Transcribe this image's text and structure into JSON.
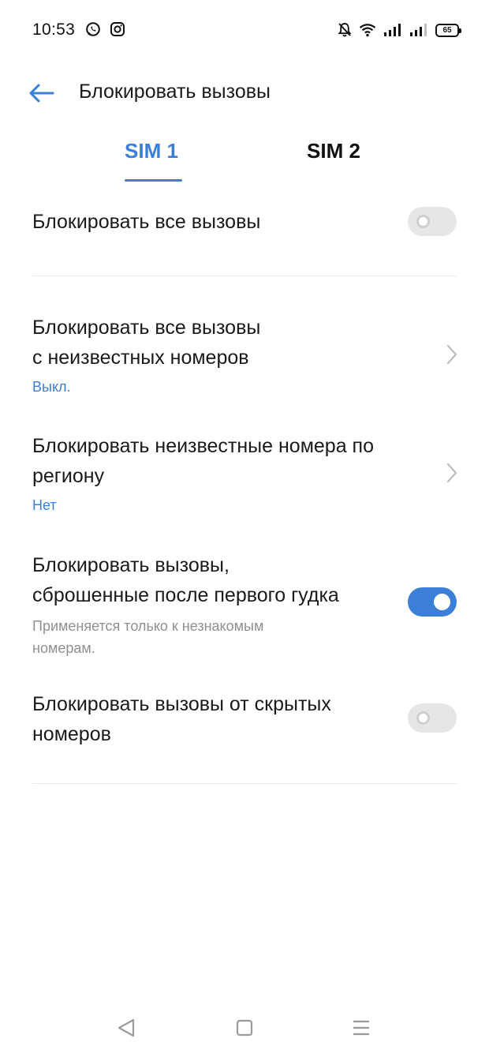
{
  "status_bar": {
    "time": "10:53",
    "app_icons": [
      "whatsapp-icon",
      "instagram-icon"
    ],
    "system_icons": [
      "bell-off-icon",
      "wifi-icon",
      "signal-icon",
      "signal-icon"
    ],
    "battery_level": "65"
  },
  "header": {
    "title": "Блокировать вызовы",
    "back_icon": "arrow-left-icon"
  },
  "tabs": [
    {
      "label": "SIM 1",
      "selected": true
    },
    {
      "label": "SIM 2",
      "selected": false
    }
  ],
  "settings": {
    "block_all": {
      "title": "Блокировать все вызовы",
      "enabled": false
    },
    "block_unknown": {
      "title_line1": "Блокировать все вызовы",
      "title_line2": "с неизвестных номеров",
      "value": "Выкл."
    },
    "block_region": {
      "title_line1": "Блокировать неизвестные номера по",
      "title_line2": "регион​у",
      "value": "Нет"
    },
    "block_one_ring": {
      "title_line1": "Блокировать вызовы,",
      "title_line2": "сброшенные после первого гудка",
      "desc_line1": "Применяется только к незнакомым",
      "desc_line2": "номерам.",
      "enabled": true
    },
    "block_hidden": {
      "title_line1": "Блокировать вызовы от скрытых",
      "title_line2": "номеров",
      "enabled": false
    }
  },
  "colors": {
    "accent": "#3a7fd8",
    "toggle_off": "#e6e6e6",
    "divider": "#e9e9e9",
    "secondary_text": "#8f8f8f"
  },
  "nav_bar": [
    "back-triangle-icon",
    "home-square-icon",
    "menu-lines-icon"
  ]
}
